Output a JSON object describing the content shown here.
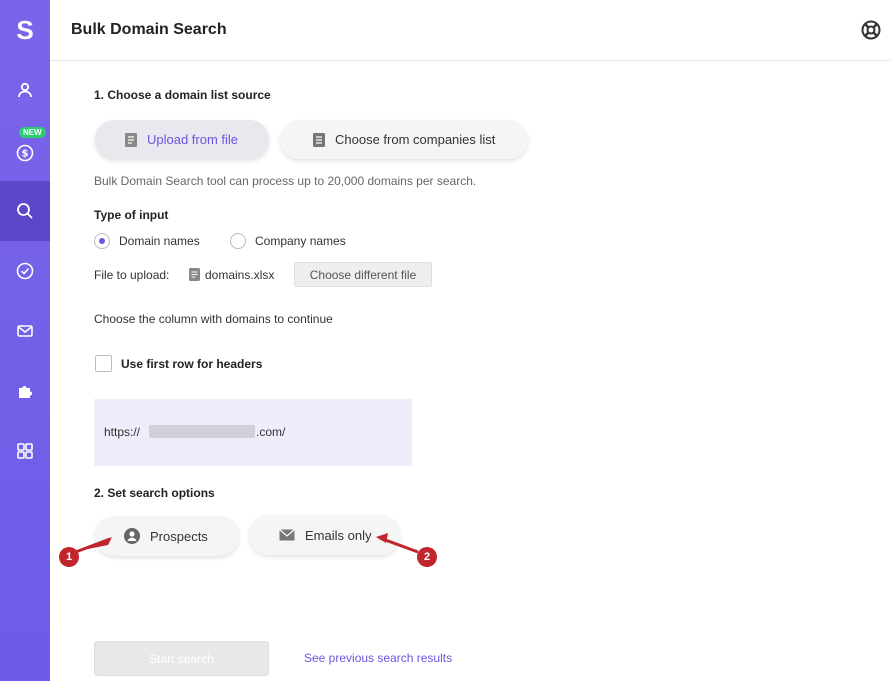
{
  "app": {
    "logo_letter": "S",
    "new_badge": "NEW"
  },
  "header": {
    "title": "Bulk Domain Search"
  },
  "step1": {
    "title": "1. Choose a domain list source",
    "upload_label": "Upload from file",
    "companies_label": "Choose from companies list",
    "hint": "Bulk Domain Search tool can process up to 20,000 domains per search."
  },
  "input_type": {
    "title": "Type of input",
    "options": [
      {
        "label": "Domain names",
        "selected": true
      },
      {
        "label": "Company names",
        "selected": false
      }
    ]
  },
  "file": {
    "label": "File to upload:",
    "filename": "domains.xlsx",
    "change_button": "Choose different file"
  },
  "column_hint": "Choose the column with domains to continue",
  "headers_checkbox": {
    "label": "Use first row for headers",
    "checked": false
  },
  "preview": {
    "prefix": "https://",
    "suffix": ".com/"
  },
  "step2": {
    "title": "2. Set search options",
    "prospects_label": "Prospects",
    "emails_label": "Emails only"
  },
  "annotations": {
    "marker1": "1",
    "marker2": "2"
  },
  "footer": {
    "start_button": "Start search",
    "previous_link": "See previous search results"
  },
  "colors": {
    "accent": "#6a57e0",
    "sidebar": "#7a65ea",
    "marker": "#c0262b"
  }
}
